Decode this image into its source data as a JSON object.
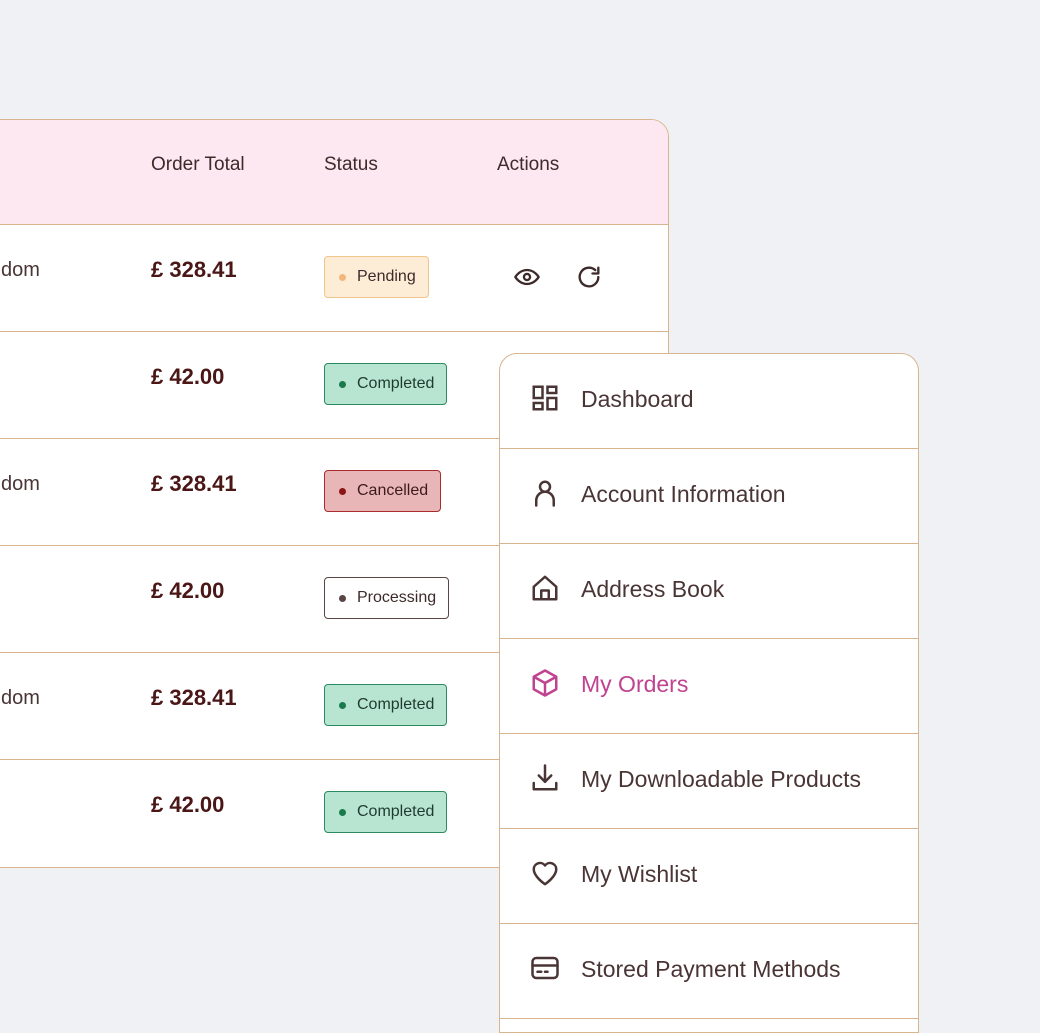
{
  "table": {
    "headers": {
      "order_total": "Order Total",
      "status": "Status",
      "actions": "Actions"
    },
    "rows": [
      {
        "country": "dom",
        "total": "£ 328.41",
        "status": "Pending",
        "status_type": "pending",
        "show_actions": true
      },
      {
        "country": "",
        "total": "£ 42.00",
        "status": "Completed",
        "status_type": "completed",
        "show_actions": false
      },
      {
        "country": "dom",
        "total": "£ 328.41",
        "status": "Cancelled",
        "status_type": "cancelled",
        "show_actions": false
      },
      {
        "country": "",
        "total": "£ 42.00",
        "status": "Processing",
        "status_type": "processing",
        "show_actions": false
      },
      {
        "country": "dom",
        "total": "£ 328.41",
        "status": "Completed",
        "status_type": "completed",
        "show_actions": false
      },
      {
        "country": "",
        "total": "£ 42.00",
        "status": "Completed",
        "status_type": "completed",
        "show_actions": false
      }
    ],
    "action_icons": [
      "eye-icon",
      "refresh-icon"
    ]
  },
  "menu": {
    "items": [
      {
        "label": "Dashboard",
        "icon": "dashboard-icon",
        "active": false
      },
      {
        "label": "Account Information",
        "icon": "user-icon",
        "active": false
      },
      {
        "label": "Address Book",
        "icon": "home-icon",
        "active": false
      },
      {
        "label": "My Orders",
        "icon": "box-icon",
        "active": true
      },
      {
        "label": "My Downloadable Products",
        "icon": "download-icon",
        "active": false
      },
      {
        "label": "My Wishlist",
        "icon": "heart-icon",
        "active": false
      },
      {
        "label": "Stored Payment Methods",
        "icon": "credit-card-icon",
        "active": false
      }
    ]
  },
  "colors": {
    "header_bg": "#fde8f2",
    "border": "#d8b58f",
    "active_menu": "#c0438f",
    "total_text": "#4a1616"
  }
}
